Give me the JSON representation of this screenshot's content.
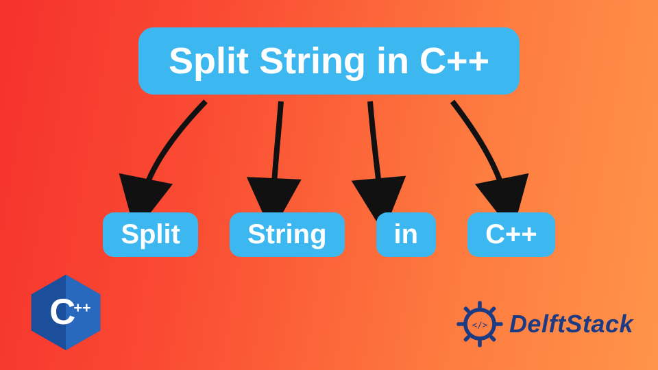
{
  "title": "Split String in C++",
  "tokens": [
    "Split",
    "String",
    "in",
    "C++"
  ],
  "brand": "DelftStack",
  "colors": {
    "box_bg": "#3db7f0",
    "box_fg": "#ffffff",
    "brand_fg": "#1c3b82",
    "gradient_from": "#f5322d",
    "gradient_to": "#ff944a"
  },
  "logos": {
    "cpp": "cpp-logo",
    "delft": "delftstack-logo"
  }
}
